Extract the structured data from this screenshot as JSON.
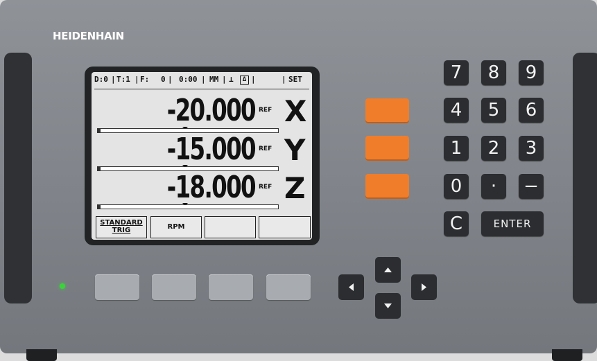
{
  "brand": "HEIDENHAIN",
  "status_bar": {
    "datum": "D:0",
    "tool": "T:1",
    "feed_label": "F:",
    "feed": "0",
    "time": "0:00",
    "units": "MM",
    "mode_icon": "tool-offset-icon",
    "delta_icon": "delta-icon",
    "mode": "SET"
  },
  "axes": [
    {
      "label": "X",
      "value": "-20.000",
      "ref": "REF"
    },
    {
      "label": "Y",
      "value": "-15.000",
      "ref": "REF"
    },
    {
      "label": "Z",
      "value": "-18.000",
      "ref": "REF"
    }
  ],
  "softkeys": [
    {
      "label_top": "STANDARD",
      "label_bottom": "TRIG"
    },
    {
      "label_top": "RPM",
      "label_bottom": ""
    },
    {
      "label_top": "",
      "label_bottom": ""
    },
    {
      "label_top": "",
      "label_bottom": ""
    }
  ],
  "keypad": {
    "k7": "7",
    "k8": "8",
    "k9": "9",
    "k4": "4",
    "k5": "5",
    "k6": "6",
    "k1": "1",
    "k2": "2",
    "k3": "3",
    "k0": "0",
    "dot": "·",
    "minus": "−",
    "clear": "C",
    "enter": "ENTER"
  },
  "colors": {
    "axis_key": "#f07d2a",
    "led": "#3bd23b",
    "lcd": "#e4e4e4",
    "housing": "#85898e"
  }
}
